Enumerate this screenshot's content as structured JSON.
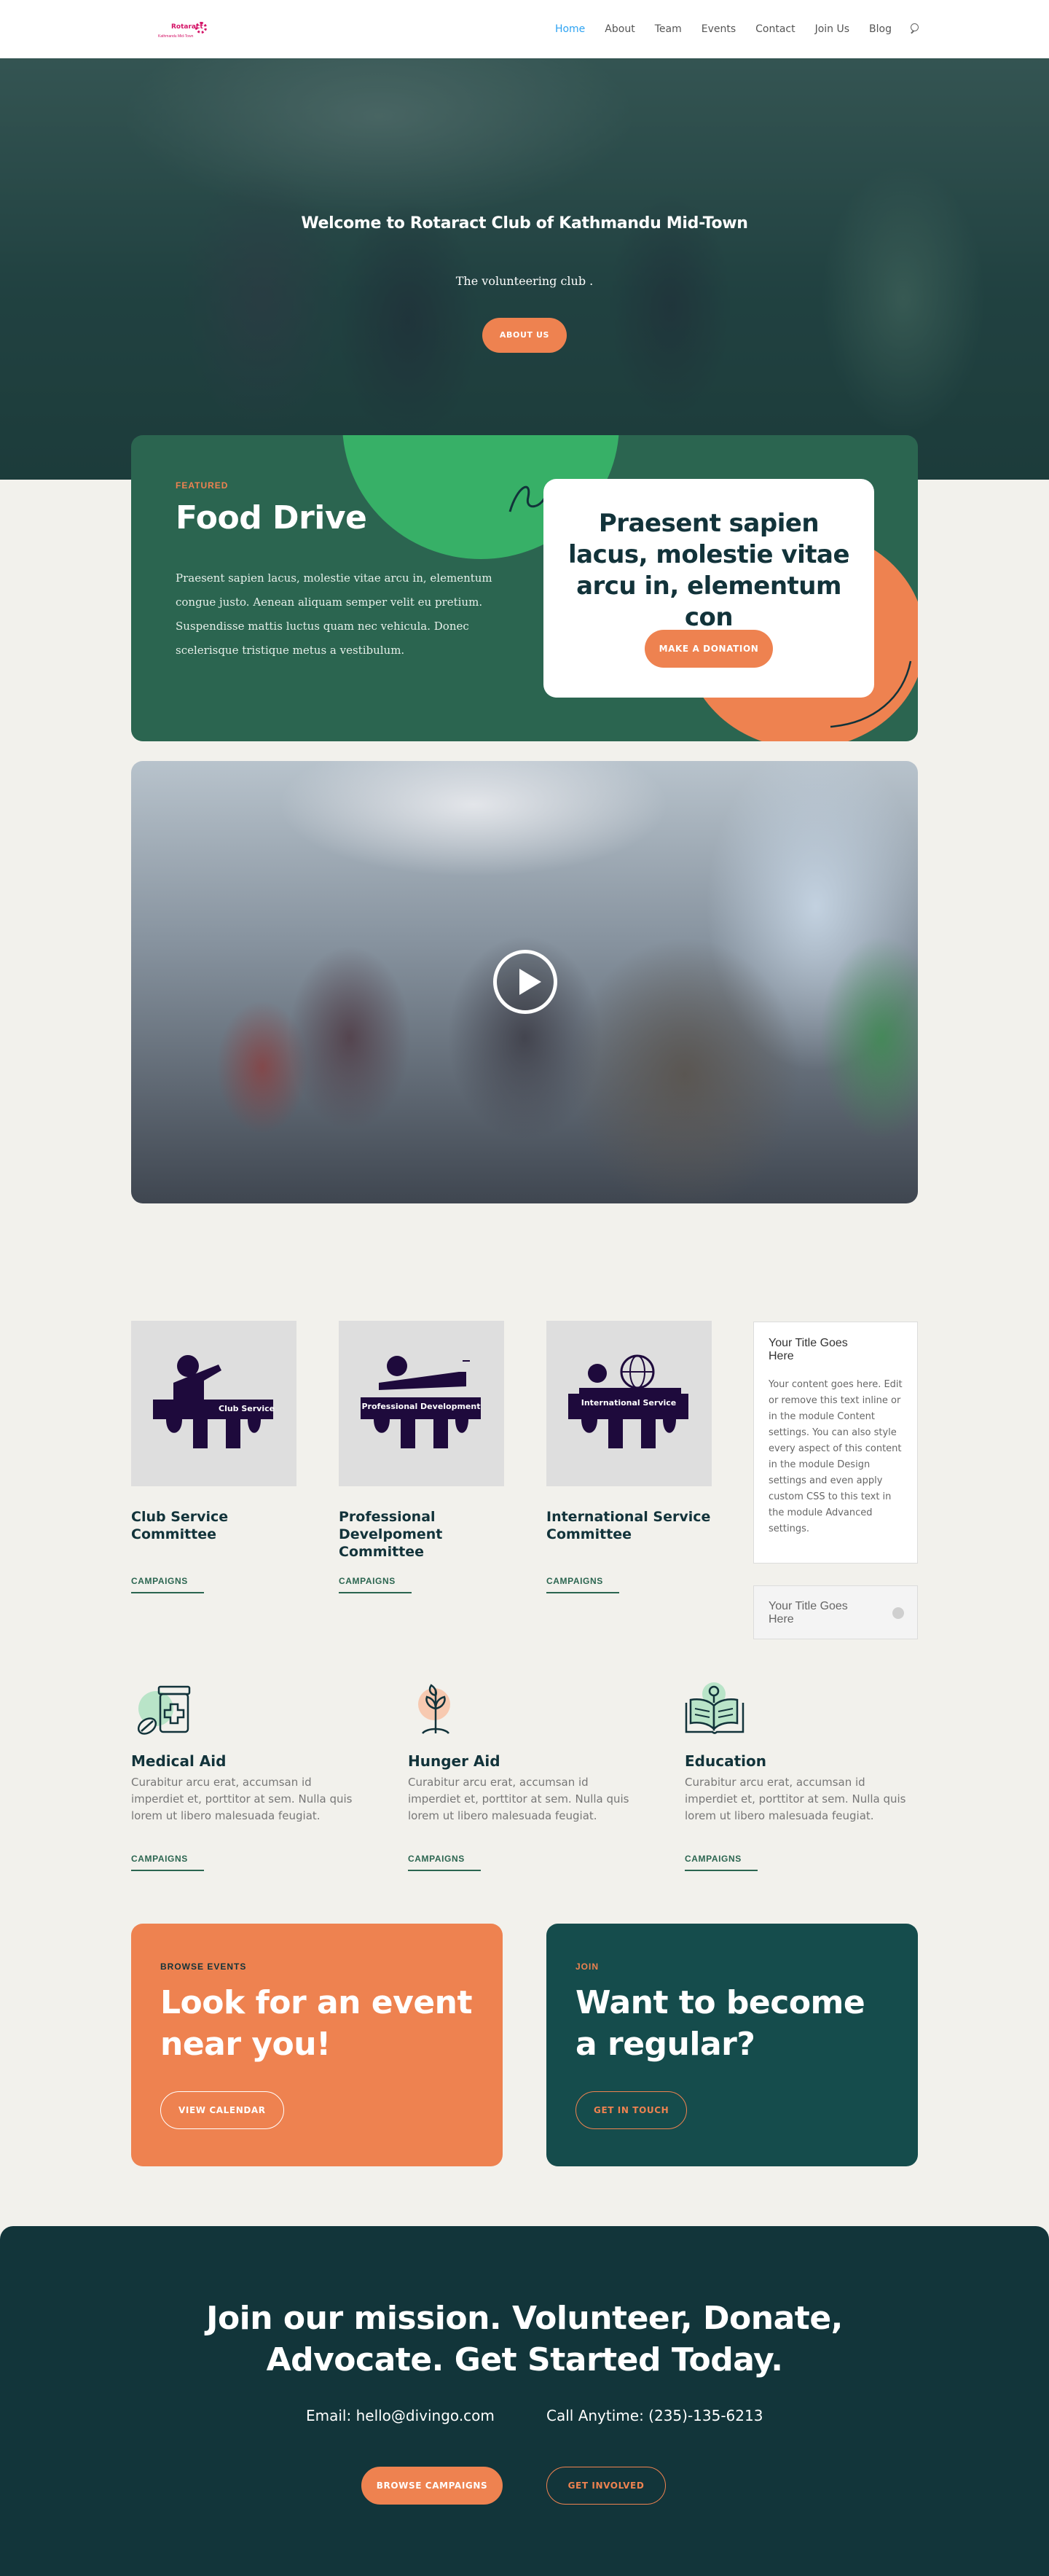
{
  "header": {
    "logo_word": "Rotaract",
    "logo_sub": "Kathmandu Mid-Town",
    "nav": [
      "Home",
      "About",
      "Team",
      "Events",
      "Contact",
      "Join Us",
      "Blog"
    ]
  },
  "hero": {
    "title": "Welcome to Rotaract Club of Kathmandu Mid-Town",
    "subtitle": "The volunteering club .",
    "button": "ABOUT US"
  },
  "featured": {
    "tag": "FEATURED",
    "title": "Food Drive",
    "body": "Praesent sapien lacus, molestie vitae arcu in, elementum congue justo. Aenean aliquam semper velit eu pretium. Suspendisse mattis luctus quam nec vehicula. Donec scelerisque tristique metus a vestibulum.",
    "card_title": "Praesent sapien lacus, molestie vitae arcu in, elementum con",
    "card_button": "MAKE A DONATION"
  },
  "committees": [
    {
      "image_label": "Club Service",
      "name": "Club Service Committee",
      "link": "CAMPAIGNS"
    },
    {
      "image_label": "Professional Development",
      "name": "Professional Develpoment Committee",
      "link": "CAMPAIGNS"
    },
    {
      "image_label": "International Service",
      "name": "International Service Committee",
      "link": "CAMPAIGNS"
    }
  ],
  "toggle": {
    "open_title": "Your Title Goes Here",
    "open_body": "Your content goes here. Edit or remove this text inline or in the module Content settings. You can also style every aspect of this content in the module Design settings and even apply custom CSS to this text in the module Advanced settings.",
    "closed_title": "Your Title Goes Here"
  },
  "features": [
    {
      "icon": "medicine-bottle-icon",
      "title": "Medical Aid",
      "body": "Curabitur arcu erat, accumsan id imperdiet et, porttitor at sem. Nulla quis lorem ut libero malesuada feugiat.",
      "link": "CAMPAIGNS"
    },
    {
      "icon": "plant-sprout-icon",
      "title": "Hunger Aid",
      "body": "Curabitur arcu erat, accumsan id imperdiet et, porttitor at sem. Nulla quis lorem ut libero malesuada feugiat.",
      "link": "CAMPAIGNS"
    },
    {
      "icon": "open-book-icon",
      "title": "Education",
      "body": "Curabitur arcu erat, accumsan id imperdiet et, porttitor at sem. Nulla quis lorem ut libero malesuada feugiat.",
      "link": "CAMPAIGNS"
    }
  ],
  "cta": {
    "events_tag": "BROWSE EVENTS",
    "events_title": "Look for an event near you!",
    "events_button": "VIEW CALENDAR",
    "join_tag": "JOIN",
    "join_title": "Want to become a regular?",
    "join_button": "GET IN TOUCH"
  },
  "footer": {
    "title": "Join our mission. Volunteer, Donate, Advocate. Get Started Today.",
    "email": "Email: hello@divingo.com",
    "phone": "Call Anytime: (235)-135-6213",
    "primary_button": "BROWSE CAMPAIGNS",
    "secondary_button": "GET INVOLVED"
  },
  "colors": {
    "accent_orange": "#ee8250",
    "dark_green": "#2b6550",
    "teal_dark": "#154c4c",
    "footer_bg": "#12353a",
    "nav_active": "#2ea3f2",
    "logo_pink": "#d41367"
  }
}
